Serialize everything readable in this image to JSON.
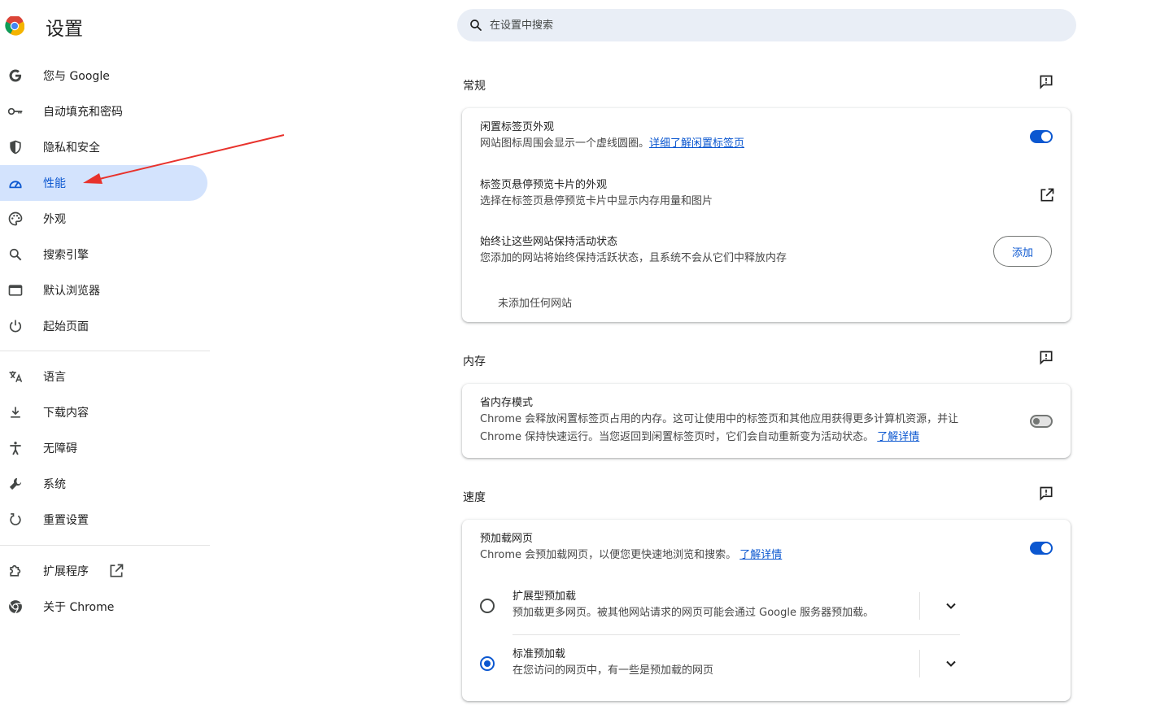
{
  "app": {
    "title": "设置",
    "logo_icon": "chrome-logo-icon"
  },
  "search": {
    "placeholder": "在设置中搜索",
    "icon": "search-icon"
  },
  "sidebar": {
    "items": [
      {
        "label": "您与 Google",
        "icon": "google-g-icon"
      },
      {
        "label": "自动填充和密码",
        "icon": "key-icon"
      },
      {
        "label": "隐私和安全",
        "icon": "shield-icon"
      },
      {
        "label": "性能",
        "icon": "speedometer-icon",
        "active": true
      },
      {
        "label": "外观",
        "icon": "palette-icon"
      },
      {
        "label": "搜索引擎",
        "icon": "search-icon"
      },
      {
        "label": "默认浏览器",
        "icon": "browser-window-icon"
      },
      {
        "label": "起始页面",
        "icon": "power-icon"
      },
      {
        "label": "语言",
        "icon": "translate-icon"
      },
      {
        "label": "下载内容",
        "icon": "download-icon"
      },
      {
        "label": "无障碍",
        "icon": "accessibility-icon"
      },
      {
        "label": "系统",
        "icon": "wrench-icon"
      },
      {
        "label": "重置设置",
        "icon": "reset-icon"
      },
      {
        "label": "扩展程序",
        "icon": "puzzle-icon"
      },
      {
        "label": "关于 Chrome",
        "icon": "chrome-logo-icon"
      }
    ]
  },
  "sections": {
    "general": {
      "title": "常规",
      "inactive_tabs": {
        "title": "闲置标签页外观",
        "desc": "网站图标周围会显示一个虚线圆圈。",
        "link": "详细了解闲置标签页",
        "enabled": true
      },
      "hover_card": {
        "title": "标签页悬停预览卡片的外观",
        "desc": "选择在标签页悬停预览卡片中显示内存用量和图片"
      },
      "keep_active": {
        "title": "始终让这些网站保持活动状态",
        "desc": "您添加的网站将始终保持活跃状态，且系统不会从它们中释放内存",
        "button": "添加",
        "empty": "未添加任何网站"
      }
    },
    "memory": {
      "title": "内存",
      "saver": {
        "title": "省内存模式",
        "desc_line1": "Chrome 会释放闲置标签页占用的内存。这可让使用中的标签页和其他应用获得更多计算机资源，并让",
        "desc_line2": "Chrome 保持快速运行。当您返回到闲置标签页时，它们会自动重新变为活动状态。",
        "link": "了解详情",
        "enabled": false
      }
    },
    "speed": {
      "title": "速度",
      "preload": {
        "title": "预加载网页",
        "desc": "Chrome 会预加载网页，以便您更快速地浏览和搜索。",
        "link": "了解详情",
        "enabled": true
      },
      "extended": {
        "title": "扩展型预加载",
        "desc": "预加载更多网页。被其他网站请求的网页可能会通过 Google 服务器预加载。",
        "selected": false
      },
      "standard": {
        "title": "标准预加载",
        "desc": "在您访问的网页中，有一些是预加载的网页",
        "selected": true
      }
    }
  },
  "colors": {
    "accent": "#0b57d0",
    "active_bg": "#d3e3fd",
    "search_bg": "#e9eef6",
    "annotation": "#e8322c"
  }
}
